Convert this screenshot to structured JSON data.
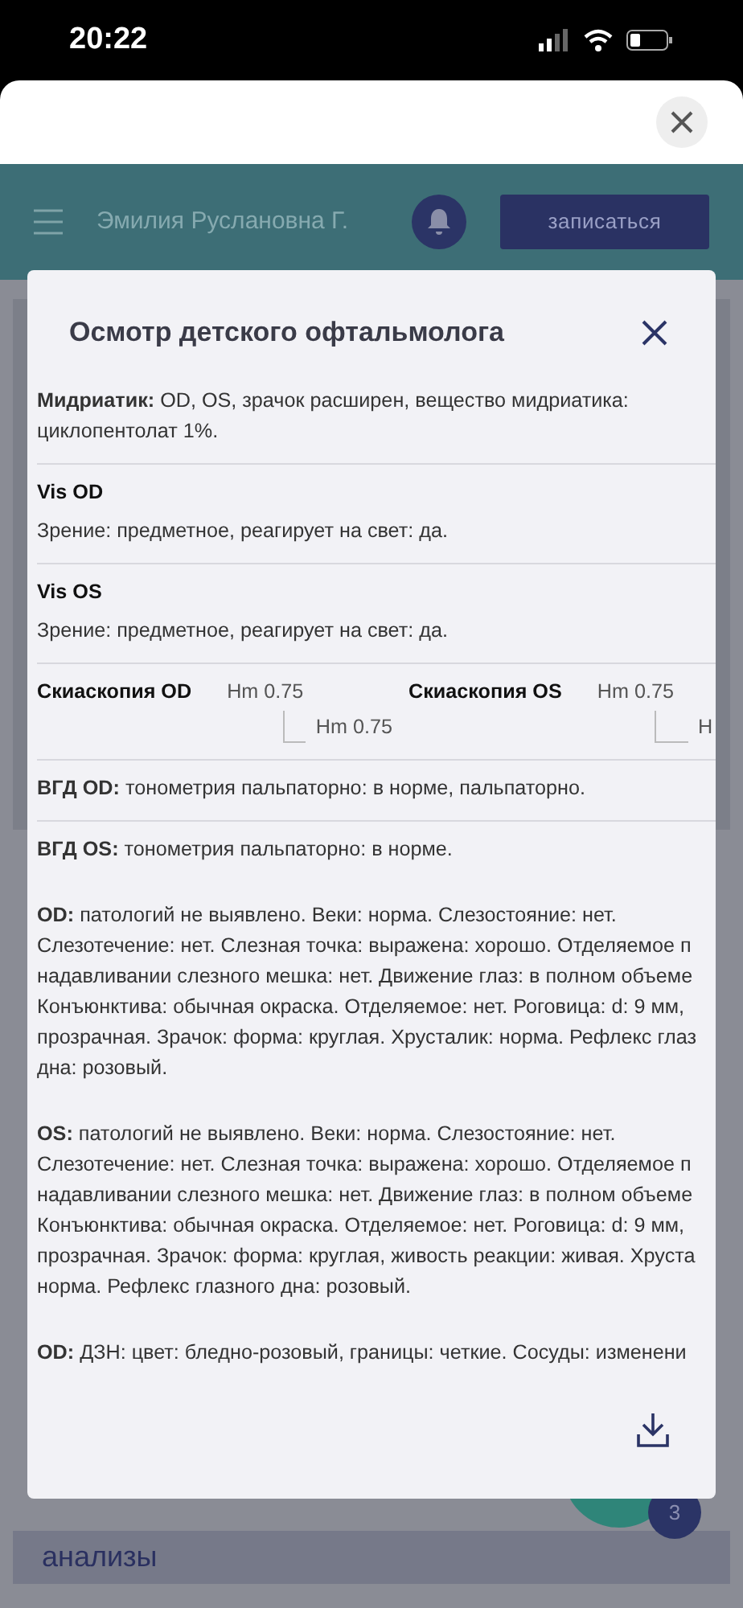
{
  "status_bar": {
    "time": "20:22"
  },
  "header": {
    "user_name": "Эмилия Руслановна Г.",
    "signup_button": "записаться"
  },
  "modal": {
    "title": "Осмотр детского офтальмолога",
    "sections": [
      {
        "kind": "lines",
        "divider": true,
        "lines": [
          "**Мидриатик:** OD, OS, зрачок расширен, вещество мидриатика:",
          "циклопентолат 1%."
        ]
      },
      {
        "kind": "titled",
        "divider": true,
        "heading": "Vis OD",
        "lines": [
          "Зрение: предметное, реагирует на свет: да."
        ]
      },
      {
        "kind": "titled",
        "divider": true,
        "heading": "Vis OS",
        "lines": [
          "Зрение: предметное, реагирует на свет: да."
        ]
      },
      {
        "kind": "skiascopy",
        "divider": true,
        "eyes": [
          {
            "label": "Скиаскопия OD",
            "values": [
              "Hm 0.75",
              "Hm 0.75"
            ]
          },
          {
            "label": "Скиаскопия OS",
            "values": [
              "Hm 0.75",
              "H"
            ]
          }
        ]
      },
      {
        "kind": "lines",
        "divider": true,
        "lines": [
          "**ВГД OD:** тонометрия пальпаторно: в норме, пальпаторно."
        ]
      },
      {
        "kind": "lines",
        "divider": false,
        "lines": [
          "**ВГД OS:** тонометрия пальпаторно: в норме."
        ]
      },
      {
        "kind": "lines",
        "divider": false,
        "lines": [
          "**OD:** патологий не выявлено. Веки: норма. Слезостояние: нет.",
          "Слезотечение: нет. Слезная точка: выражена: хорошо. Отделяемое п",
          "надавливании слезного мешка: нет. Движение глаз: в полном объеме",
          "Конъюнктива: обычная окраска. Отделяемое: нет. Роговица: d: 9 мм,",
          "прозрачная. Зрачок: форма: круглая. Хрусталик: норма. Рефлекс глаз",
          "дна: розовый."
        ]
      },
      {
        "kind": "lines",
        "divider": false,
        "lines": [
          "**OS:** патологий не выявлено. Веки: норма. Слезостояние: нет.",
          "Слезотечение: нет. Слезная точка: выражена: хорошо. Отделяемое п",
          "надавливании слезного мешка: нет. Движение глаз: в полном объеме",
          "Конъюнктива: обычная окраска. Отделяемое: нет. Роговица: d: 9 мм,",
          "прозрачная. Зрачок: форма: круглая, живость реакции: живая. Хруста",
          "норма. Рефлекс глазного дна: розовый."
        ]
      },
      {
        "kind": "lines",
        "divider": false,
        "lines": [
          "**OD:** ДЗН: цвет: бледно-розовый, границы: четкие. Сосуды: изменени"
        ]
      }
    ]
  },
  "section_bar": {
    "title": "анализы"
  },
  "help_badge": {
    "count": "3"
  }
}
